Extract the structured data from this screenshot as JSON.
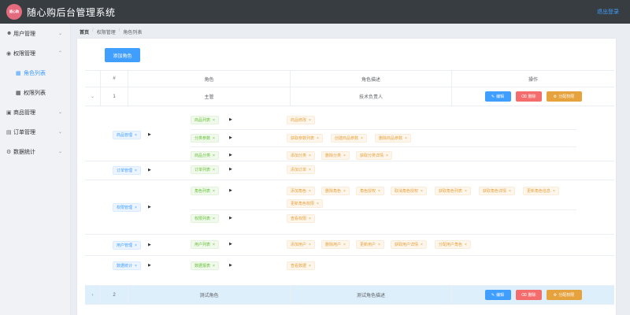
{
  "header": {
    "logo_text": "随心购",
    "title": "随心购后台管理系统",
    "logout": "退出登录"
  },
  "sidebar": {
    "menus": [
      {
        "icon": "user-icon",
        "label": "用户管理"
      },
      {
        "icon": "shield-icon",
        "label": "权限管理",
        "children": [
          {
            "icon": "grid-icon",
            "label": "角色列表",
            "active": true
          },
          {
            "icon": "grid-icon",
            "label": "权限列表"
          }
        ]
      },
      {
        "icon": "box-icon",
        "label": "商品管理"
      },
      {
        "icon": "document-icon",
        "label": "订单管理"
      },
      {
        "icon": "chart-icon",
        "label": "数据统计"
      }
    ]
  },
  "breadcrumb": [
    "首页",
    "权限管理",
    "角色列表"
  ],
  "add_role_label": "添加角色",
  "table": {
    "headers": [
      "#",
      "角色",
      "角色描述",
      "操作"
    ],
    "buttons": {
      "edit": "编辑",
      "delete": "删除",
      "assign": "分配权限"
    },
    "rows": [
      {
        "index": "1",
        "name": "主管",
        "desc": "技术负责人"
      },
      {
        "index": "2",
        "name": "测试角色",
        "desc": "测试角色描述"
      }
    ]
  },
  "rights": [
    {
      "l1": "商品管理",
      "subs": [
        {
          "l2": "商品列表",
          "l3": [
            "商品修改"
          ]
        },
        {
          "l2": "分类参数",
          "l3": [
            "获取参数列表",
            "创建商品参数",
            "删除商品参数"
          ]
        },
        {
          "l2": "商品分类",
          "l3": [
            "添加分类",
            "删除分类",
            "获取分类详情"
          ]
        }
      ]
    },
    {
      "l1": "订单管理",
      "subs": [
        {
          "l2": "订单列表",
          "l3": [
            "添加订单"
          ]
        }
      ]
    },
    {
      "l1": "权限管理",
      "subs": [
        {
          "l2": "角色列表",
          "l3": [
            "添加角色",
            "删除角色",
            "角色授权",
            "取消角色授权",
            "获取角色列表",
            "获取角色详情",
            "更新角色信息",
            "更新角色权限"
          ]
        },
        {
          "l2": "权限列表",
          "l3": [
            "查看权限"
          ]
        }
      ]
    },
    {
      "l1": "用户管理",
      "subs": [
        {
          "l2": "用户列表",
          "l3": [
            "添加用户",
            "删除用户",
            "更新用户",
            "获取用户详情",
            "分配用户角色"
          ]
        }
      ]
    },
    {
      "l1": "数据统计",
      "subs": [
        {
          "l2": "数据报表",
          "l3": [
            "查看数据"
          ]
        }
      ]
    }
  ],
  "icons": {
    "expand": "chevron-down-icon",
    "collapse": "chevron-right-icon",
    "tag_close": "close-icon",
    "caret": "caret-right-icon"
  },
  "colors": {
    "primary": "#409eff",
    "danger": "#f56c6c",
    "warning": "#e6a23c",
    "success": "#67c23a",
    "header": "#373d41"
  }
}
